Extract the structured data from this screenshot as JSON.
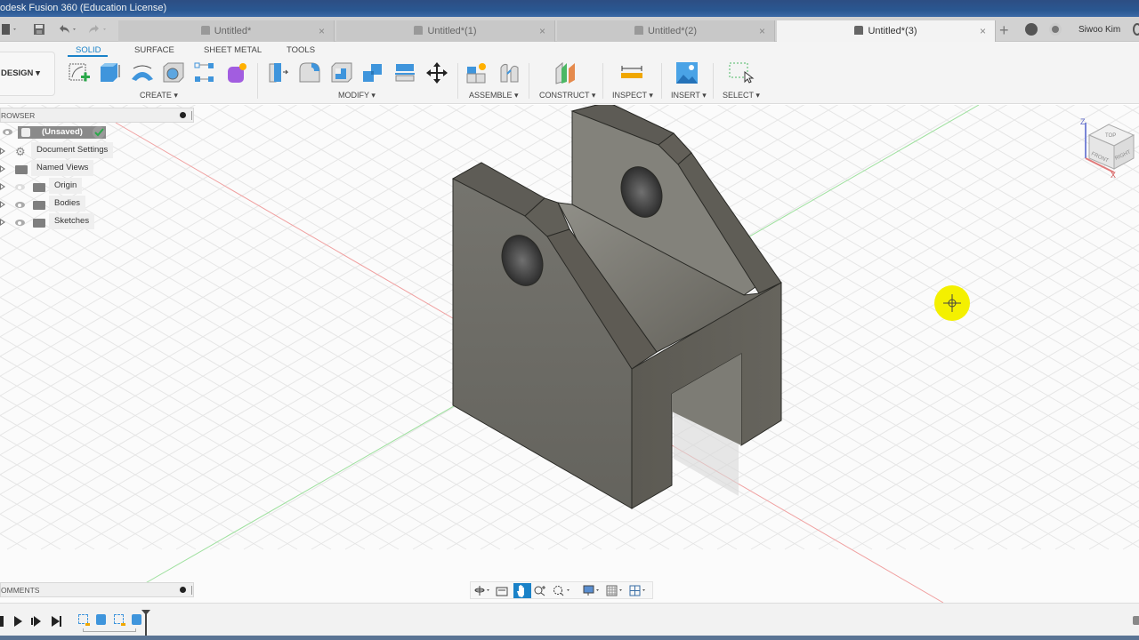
{
  "window": {
    "title": "odesk Fusion 360 (Education License)"
  },
  "tabs": [
    {
      "label": "Untitled*",
      "active": false
    },
    {
      "label": "Untitled*(1)",
      "active": false
    },
    {
      "label": "Untitled*(2)",
      "active": false
    },
    {
      "label": "Untitled*(3)",
      "active": true
    }
  ],
  "header": {
    "user_name": "Siwoo Kim",
    "new_tab_icon": "plus-icon",
    "job_status_icon": "job-status-icon",
    "notifications_icon": "clock-icon"
  },
  "toolbar": {
    "workspace": "DESIGN",
    "workspace_tabs": [
      "SOLID",
      "SURFACE",
      "SHEET METAL",
      "TOOLS"
    ],
    "active_workspace_tab": "SOLID",
    "groups": [
      {
        "label": "CREATE",
        "tools": [
          "create-sketch",
          "extrude",
          "revolve",
          "hole",
          "pattern",
          "create-form"
        ]
      },
      {
        "label": "MODIFY",
        "tools": [
          "press-pull",
          "fillet",
          "shell",
          "combine",
          "offset-plane",
          "move"
        ]
      },
      {
        "label": "ASSEMBLE",
        "tools": [
          "new-component",
          "joint"
        ]
      },
      {
        "label": "CONSTRUCT",
        "tools": [
          "offset-plane"
        ]
      },
      {
        "label": "INSPECT",
        "tools": [
          "measure"
        ]
      },
      {
        "label": "INSERT",
        "tools": [
          "insert-image"
        ]
      },
      {
        "label": "SELECT",
        "tools": [
          "select-window"
        ]
      }
    ]
  },
  "browser": {
    "title": "ROWSER",
    "root": "(Unsaved)",
    "items": [
      {
        "label": "Document Settings",
        "icon": "gear-icon"
      },
      {
        "label": "Named Views",
        "icon": "folder-icon"
      },
      {
        "label": "Origin",
        "icon": "folder-icon",
        "visible": false
      },
      {
        "label": "Bodies",
        "icon": "folder-icon",
        "visible": true
      },
      {
        "label": "Sketches",
        "icon": "folder-icon",
        "visible": true
      }
    ]
  },
  "viewcube": {
    "faces": [
      "TOP",
      "FRONT",
      "RIGHT"
    ],
    "axes": [
      "Z",
      "X"
    ]
  },
  "comments": {
    "title": "OMMENTS"
  },
  "navbar": {
    "tools": [
      "orbit",
      "look-at",
      "pan",
      "zoom",
      "fit",
      "display-settings",
      "grid-settings",
      "viewports"
    ],
    "active": "pan"
  },
  "timeline": {
    "controls": [
      "go-to-start",
      "previous",
      "play",
      "next",
      "go-to-end"
    ],
    "features": [
      "sketch",
      "extrude",
      "sketch",
      "extrude"
    ]
  },
  "colors": {
    "accent": "#1a82c8",
    "body": "#6b6a64",
    "cursor_highlight": "#f4f000"
  }
}
